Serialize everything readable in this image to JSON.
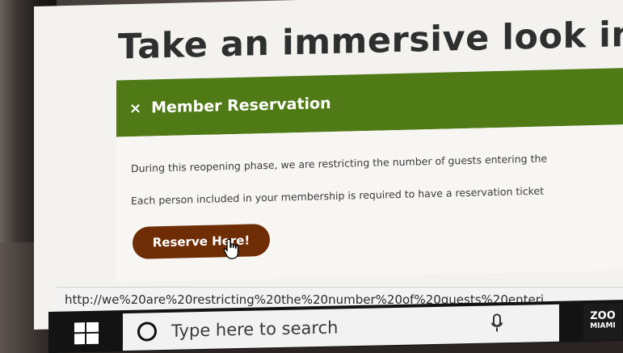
{
  "page": {
    "headline": "Take an immersive look inside"
  },
  "reservation_panel": {
    "close_symbol": "×",
    "title": "Member Reservation",
    "paragraph_1": "During this reopening phase, we are restricting the number of guests entering the",
    "paragraph_2": "Each person included in your membership is required to have a reservation ticket",
    "reserve_button_label": "Reserve Here!"
  },
  "status_bar": {
    "url": "http://we%20are%20restricting%20the%20number%20of%20guests%20enteri"
  },
  "taskbar": {
    "search_placeholder": "Type here to search",
    "start_icon": "windows-logo-icon",
    "search_icon": "cortana-circle-icon",
    "mic_icon": "microphone-icon"
  },
  "watermark": {
    "line1": "ZOO",
    "line2": "MIAMI"
  },
  "colors": {
    "panel_header": "#4f7a16",
    "button": "#6e2d05",
    "taskbar": "#131313"
  }
}
